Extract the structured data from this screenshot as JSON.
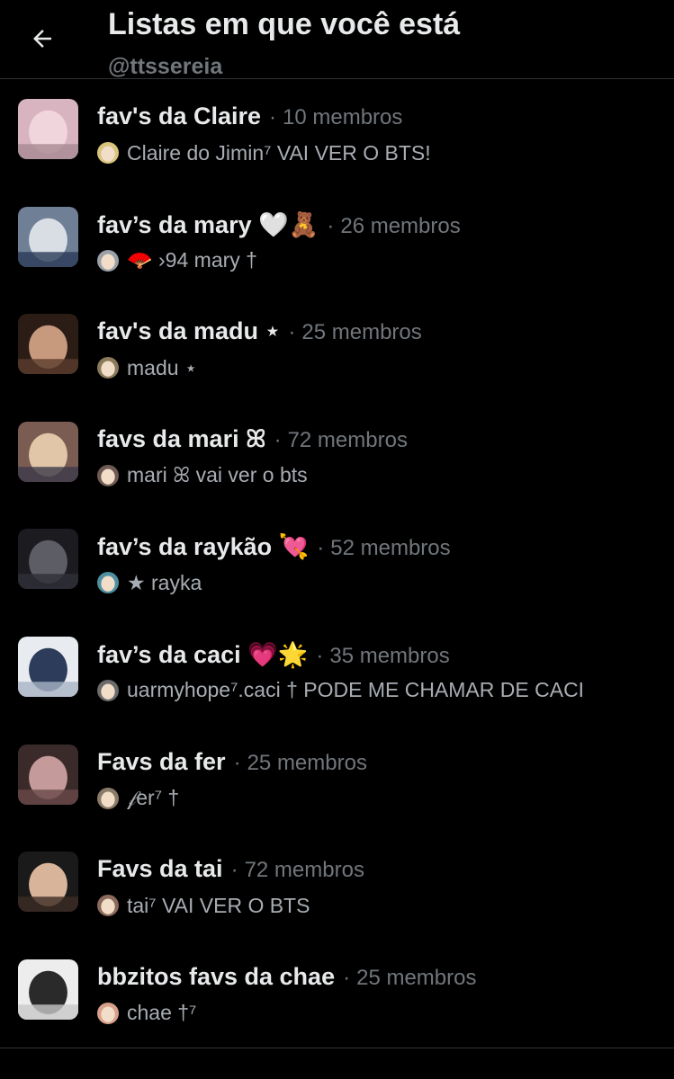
{
  "header": {
    "title": "Listas em que você está",
    "handle": "@ttssereia",
    "back_icon": "arrow-left-icon"
  },
  "lists": [
    {
      "name": "fav's da Claire",
      "separator": "·",
      "members": "10 membros",
      "owner": "Claire do Jimin⁷ VAI VER O BTS!",
      "thumb_colors": [
        "#d8b3c0",
        "#f0d6dc",
        "#a88a92"
      ],
      "owner_avatar_color": "#d8c47a"
    },
    {
      "name": "fav’s da mary 🤍🧸",
      "separator": "·",
      "members": "26 membros",
      "owner": "🪭 ›94 mary †",
      "thumb_colors": [
        "#6e7f96",
        "#d9dee5",
        "#2a3b58"
      ],
      "owner_avatar_color": "#9aa0a8"
    },
    {
      "name": "fav's da madu ⋆",
      "separator": "·",
      "members": "25 membros",
      "owner": "madu ⋆",
      "thumb_colors": [
        "#2b1d16",
        "#c79a7e",
        "#5a3c2d"
      ],
      "owner_avatar_color": "#8a7a5a"
    },
    {
      "name": "favs da mari ꕤ",
      "separator": "·",
      "members": "72 membros",
      "owner": "mari ꕤ vai ver o bts",
      "thumb_colors": [
        "#7a5c52",
        "#e2c6a8",
        "#3c3a48"
      ],
      "owner_avatar_color": "#6e5a52"
    },
    {
      "name": "fav’s da raykão 💘",
      "separator": "·",
      "members": "52 membros",
      "owner": "★ rayka",
      "thumb_colors": [
        "#1b1b20",
        "#5d5d66",
        "#2f2f38"
      ],
      "owner_avatar_color": "#4e8fa0"
    },
    {
      "name": "fav’s da caci 💗🌟",
      "separator": "·",
      "members": "35 membros",
      "owner": "uarmyhope⁷.caci † PODE ME CHAMAR DE CACI",
      "thumb_colors": [
        "#e8ecf0",
        "#2d3c5a",
        "#a8b4c4"
      ],
      "owner_avatar_color": "#6b6b6b"
    },
    {
      "name": "Favs da fer",
      "separator": "·",
      "members": "25 membros",
      "owner": "𝒻er⁷ †",
      "thumb_colors": [
        "#3a2a2a",
        "#c49a9a",
        "#6a4848"
      ],
      "owner_avatar_color": "#8a7a68"
    },
    {
      "name": "Favs da tai",
      "separator": "·",
      "members": "72 membros",
      "owner": "tai⁷ VAI VER O BTS",
      "thumb_colors": [
        "#1a1a1a",
        "#d8b49a",
        "#3c2c24"
      ],
      "owner_avatar_color": "#8a6a5a"
    },
    {
      "name": "bbzitos favs da chae",
      "separator": "·",
      "members": "25 membros",
      "owner": "chae †⁷",
      "thumb_colors": [
        "#ededed",
        "#2a2a2a",
        "#c8c8c8"
      ],
      "owner_avatar_color": "#d8a08a"
    }
  ]
}
